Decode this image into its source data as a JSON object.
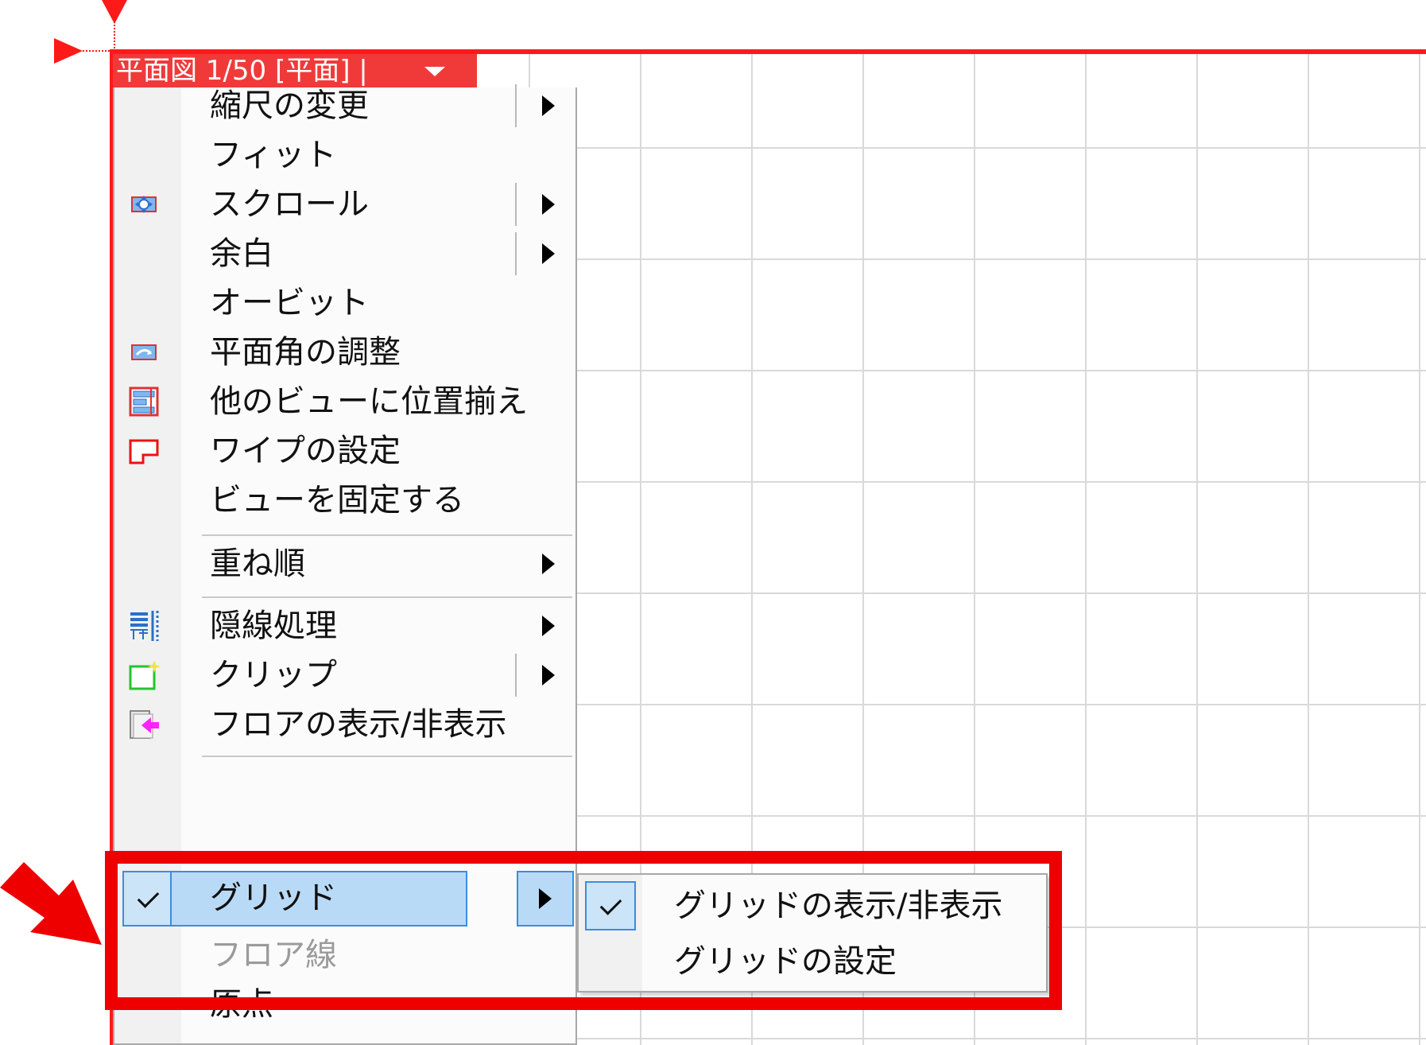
{
  "view_tab": {
    "label": "平面図 1/50 [平面] |",
    "dropdown_icon": "triangle-down-icon"
  },
  "context_menu": {
    "items": [
      {
        "label": "縮尺の変更",
        "icon": null,
        "submenu": true
      },
      {
        "label": "フィット",
        "icon": null,
        "submenu": false
      },
      {
        "label": "スクロール",
        "icon": "scroll-icon",
        "submenu": true
      },
      {
        "label": "余白",
        "icon": null,
        "submenu": true
      },
      {
        "label": "オービット",
        "icon": null,
        "submenu": false
      },
      {
        "label": "平面角の調整",
        "icon": "plan-angle-icon",
        "submenu": false
      },
      {
        "label": "他のビューに位置揃え",
        "icon": "align-views-icon",
        "submenu": false
      },
      {
        "label": "ワイプの設定",
        "icon": "wipe-icon",
        "submenu": false
      },
      {
        "label": "ビューを固定する",
        "icon": null,
        "submenu": false
      },
      {
        "label": "重ね順",
        "icon": null,
        "submenu": true
      },
      {
        "label": "隠線処理",
        "icon": "hidden-line-icon",
        "submenu": true
      },
      {
        "label": "クリップ",
        "icon": "clip-icon",
        "submenu": true
      },
      {
        "label": "フロアの表示/非表示",
        "icon": "floor-toggle-icon",
        "submenu": false
      },
      {
        "label": "グリッド",
        "icon": "check-icon",
        "submenu": true,
        "checked": true,
        "highlighted": true
      },
      {
        "label": "フロア線",
        "icon": null,
        "submenu": false,
        "disabled": true
      },
      {
        "label": "原点",
        "icon": null,
        "submenu": false
      }
    ]
  },
  "grid_submenu": {
    "items": [
      {
        "label": "グリッドの表示/非表示",
        "checked": true
      },
      {
        "label": "グリッドの設定",
        "checked": false
      }
    ]
  },
  "colors": {
    "view_accent": "#ff1a1a",
    "highlight_box": "#ee0000",
    "selected_item": "#b9daf6",
    "selected_border": "#3a8de0"
  }
}
